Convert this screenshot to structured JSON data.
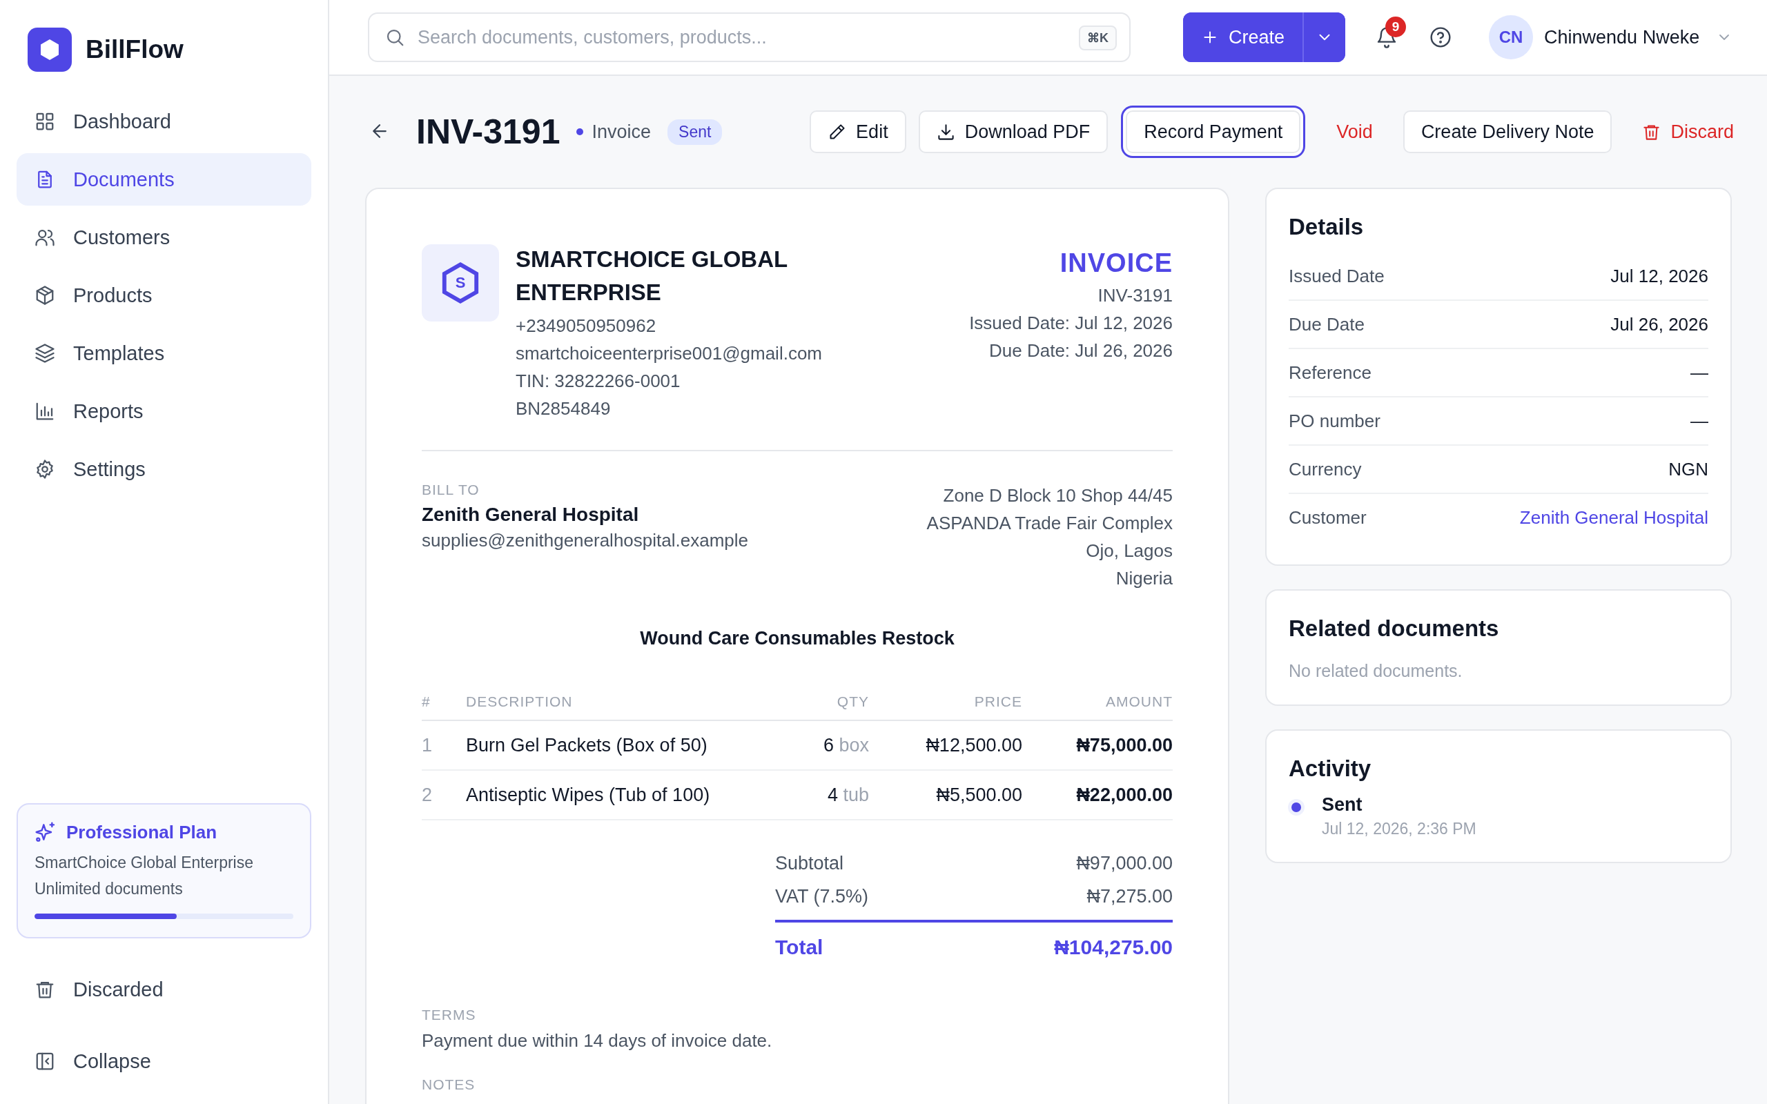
{
  "app": {
    "name": "BillFlow"
  },
  "sidebar": {
    "items": [
      {
        "label": "Dashboard",
        "selected": false
      },
      {
        "label": "Documents",
        "selected": true
      },
      {
        "label": "Customers",
        "selected": false
      },
      {
        "label": "Products",
        "selected": false
      },
      {
        "label": "Templates",
        "selected": false
      },
      {
        "label": "Reports",
        "selected": false
      },
      {
        "label": "Settings",
        "selected": false
      }
    ],
    "plan": {
      "title": "Professional Plan",
      "company": "SmartChoice Global Enterprise",
      "limit": "Unlimited documents",
      "level": 0.55
    },
    "footer_items": [
      {
        "label": "Discarded"
      },
      {
        "label": "Collapse"
      }
    ]
  },
  "topbar": {
    "search": {
      "placeholder": "Search documents, customers, products...",
      "shortcut": "⌘K"
    },
    "create_button": "Create",
    "notifications": "9",
    "user": {
      "initials": "CN",
      "name": "Chinwendu Nweke"
    }
  },
  "document_header": {
    "number": "INV-3191",
    "type": "Invoice",
    "status": "Sent",
    "actions": [
      {
        "label": "Edit",
        "kind": "edit"
      },
      {
        "label": "Download PDF",
        "kind": "download"
      },
      {
        "label": "Record Payment",
        "kind": "focused"
      },
      {
        "label": "Void",
        "kind": "danger"
      },
      {
        "label": "Create Delivery Note",
        "kind": "plain"
      },
      {
        "label": "Discard",
        "kind": "discard"
      }
    ]
  },
  "invoice": {
    "logo_letter": "S",
    "company": "SMARTCHOICE GLOBAL ENTERPRISE",
    "company_lines": [
      "+2349050950962",
      "smartchoiceenterprise001@gmail.com",
      "TIN: 32822266-0001",
      "BN2854849"
    ],
    "title": "INVOICE",
    "meta_lines": [
      "INV-3191",
      "Issued Date: Jul 12, 2026",
      "Due Date: Jul 26, 2026"
    ],
    "bill_to_label": "BILL TO",
    "customer_name": "Zenith General Hospital",
    "customer_email": "supplies@zenithgeneralhospital.example",
    "address_lines": [
      "Zone D Block 10 Shop 44/45",
      "ASPANDA Trade Fair Complex",
      "Ojo, Lagos",
      "Nigeria"
    ],
    "project": "Wound Care Consumables Restock",
    "columns": [
      "#",
      "DESCRIPTION",
      "QTY",
      "PRICE",
      "AMOUNT"
    ],
    "rows": [
      {
        "index": "1",
        "description": "Burn Gel Packets (Box of 50)",
        "qty": "6",
        "unit": "box",
        "price": "₦12,500.00",
        "amount": "₦75,000.00"
      },
      {
        "index": "2",
        "description": "Antiseptic Wipes (Tub of 100)",
        "qty": "4",
        "unit": "tub",
        "price": "₦5,500.00",
        "amount": "₦22,000.00"
      }
    ],
    "totals": [
      {
        "label": "Subtotal",
        "value": "₦97,000.00",
        "kind": "line"
      },
      {
        "label": "VAT (7.5%)",
        "value": "₦7,275.00",
        "kind": "line"
      },
      {
        "label": "Total",
        "value": "₦104,275.00",
        "kind": "total"
      }
    ],
    "terms_label": "TERMS",
    "terms": "Payment due within 14 days of invoice date.",
    "notes_label": "NOTES"
  },
  "details": {
    "title": "Details",
    "rows": [
      {
        "label": "Issued Date",
        "value": "Jul 12, 2026",
        "kind": "text"
      },
      {
        "label": "Due Date",
        "value": "Jul 26, 2026",
        "kind": "text"
      },
      {
        "label": "Reference",
        "value": "—",
        "kind": "text"
      },
      {
        "label": "PO number",
        "value": "—",
        "kind": "text"
      },
      {
        "label": "Currency",
        "value": "NGN",
        "kind": "text"
      },
      {
        "label": "Customer",
        "value": "Zenith General Hospital",
        "kind": "link"
      }
    ]
  },
  "related": {
    "title": "Related documents",
    "empty": "No related documents."
  },
  "activity": {
    "title": "Activity",
    "items": [
      {
        "event": "Sent",
        "time": "Jul 12, 2026, 2:36 PM"
      }
    ]
  }
}
